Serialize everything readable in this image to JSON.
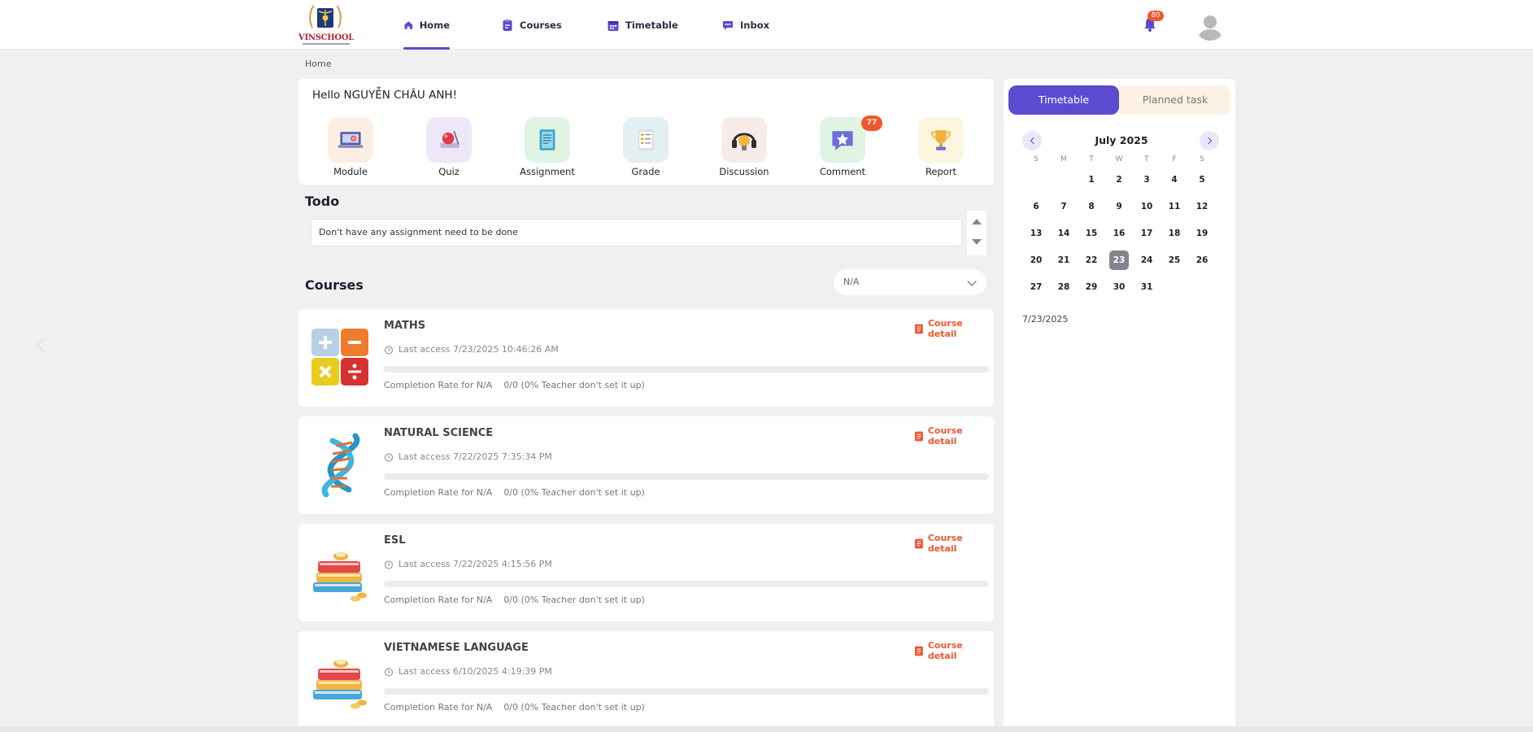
{
  "header": {
    "logo_text": "VINSCHOOL",
    "nav": [
      {
        "label": "Home",
        "icon": "home-icon",
        "active": true
      },
      {
        "label": "Courses",
        "icon": "clipboard-icon",
        "active": false
      },
      {
        "label": "Timetable",
        "icon": "calendar-icon",
        "active": false
      },
      {
        "label": "Inbox",
        "icon": "chat-icon",
        "active": false
      }
    ],
    "notifications_count": "80"
  },
  "breadcrumb": "Home",
  "welcome": {
    "greeting": "Hello NGUYỄN CHÂU ANH!",
    "shortcuts": [
      {
        "label": "Module",
        "icon": "laptop-icon",
        "color": "#fdeee3"
      },
      {
        "label": "Quiz",
        "icon": "quiz-icon",
        "color": "#eee7f7"
      },
      {
        "label": "Assignment",
        "icon": "document-icon",
        "color": "#dff4e2"
      },
      {
        "label": "Grade",
        "icon": "grade-sheet-icon",
        "color": "#e3eff2"
      },
      {
        "label": "Discussion",
        "icon": "headset-bulb-icon",
        "color": "#f7ece7"
      },
      {
        "label": "Comment",
        "icon": "comment-bubble-icon",
        "color": "#dff4e2",
        "badge": "77"
      },
      {
        "label": "Report",
        "icon": "trophy-icon",
        "color": "#fbf6dd"
      }
    ]
  },
  "todo": {
    "title": "Todo",
    "message": "Don't have any assignment need to be done"
  },
  "courses": {
    "title": "Courses",
    "filter_value": "N/A",
    "items": [
      {
        "name": "MATHS",
        "last_access": "Last access 7/23/2025 10:46:26 AM",
        "completion_label": "Completion Rate for N/A",
        "completion_value": "0/0 (0% Teacher don't set it up)",
        "progress": 0,
        "detail": "Course detail",
        "thumb": "calculator-icon"
      },
      {
        "name": "NATURAL SCIENCE",
        "last_access": "Last access 7/22/2025 7:35:34 PM",
        "completion_label": "Completion Rate for N/A",
        "completion_value": "0/0 (0% Teacher don't set it up)",
        "progress": 0,
        "detail": "Course detail",
        "thumb": "dna-icon"
      },
      {
        "name": "ESL",
        "last_access": "Last access 7/22/2025 4:15:56 PM",
        "completion_label": "Completion Rate for N/A",
        "completion_value": "0/0 (0% Teacher don't set it up)",
        "progress": 0,
        "detail": "Course detail",
        "thumb": "books-icon"
      },
      {
        "name": "VIETNAMESE LANGUAGE",
        "last_access": "Last access 6/10/2025 4:19:39 PM",
        "completion_label": "Completion Rate for N/A",
        "completion_value": "0/0 (0% Teacher don't set it up)",
        "progress": 0,
        "detail": "Course detail",
        "thumb": "books-icon"
      }
    ]
  },
  "sidebar": {
    "tabs": [
      "Timetable",
      "Planned task"
    ],
    "calendar": {
      "month_label": "July 2025",
      "weekdays": [
        "S",
        "M",
        "T",
        "W",
        "T",
        "F",
        "S"
      ],
      "weeks": [
        [
          "",
          "",
          "1",
          "2",
          "3",
          "4",
          "5"
        ],
        [
          "6",
          "7",
          "8",
          "9",
          "10",
          "11",
          "12"
        ],
        [
          "13",
          "14",
          "15",
          "16",
          "17",
          "18",
          "19"
        ],
        [
          "20",
          "21",
          "22",
          "23",
          "24",
          "25",
          "26"
        ],
        [
          "27",
          "28",
          "29",
          "30",
          "31",
          "",
          ""
        ]
      ],
      "selected_day": "23",
      "selected_date_text": "7/23/2025"
    }
  },
  "colors": {
    "accent": "#5b4bd0",
    "danger": "#f0572e",
    "background": "#f0f0f0"
  }
}
